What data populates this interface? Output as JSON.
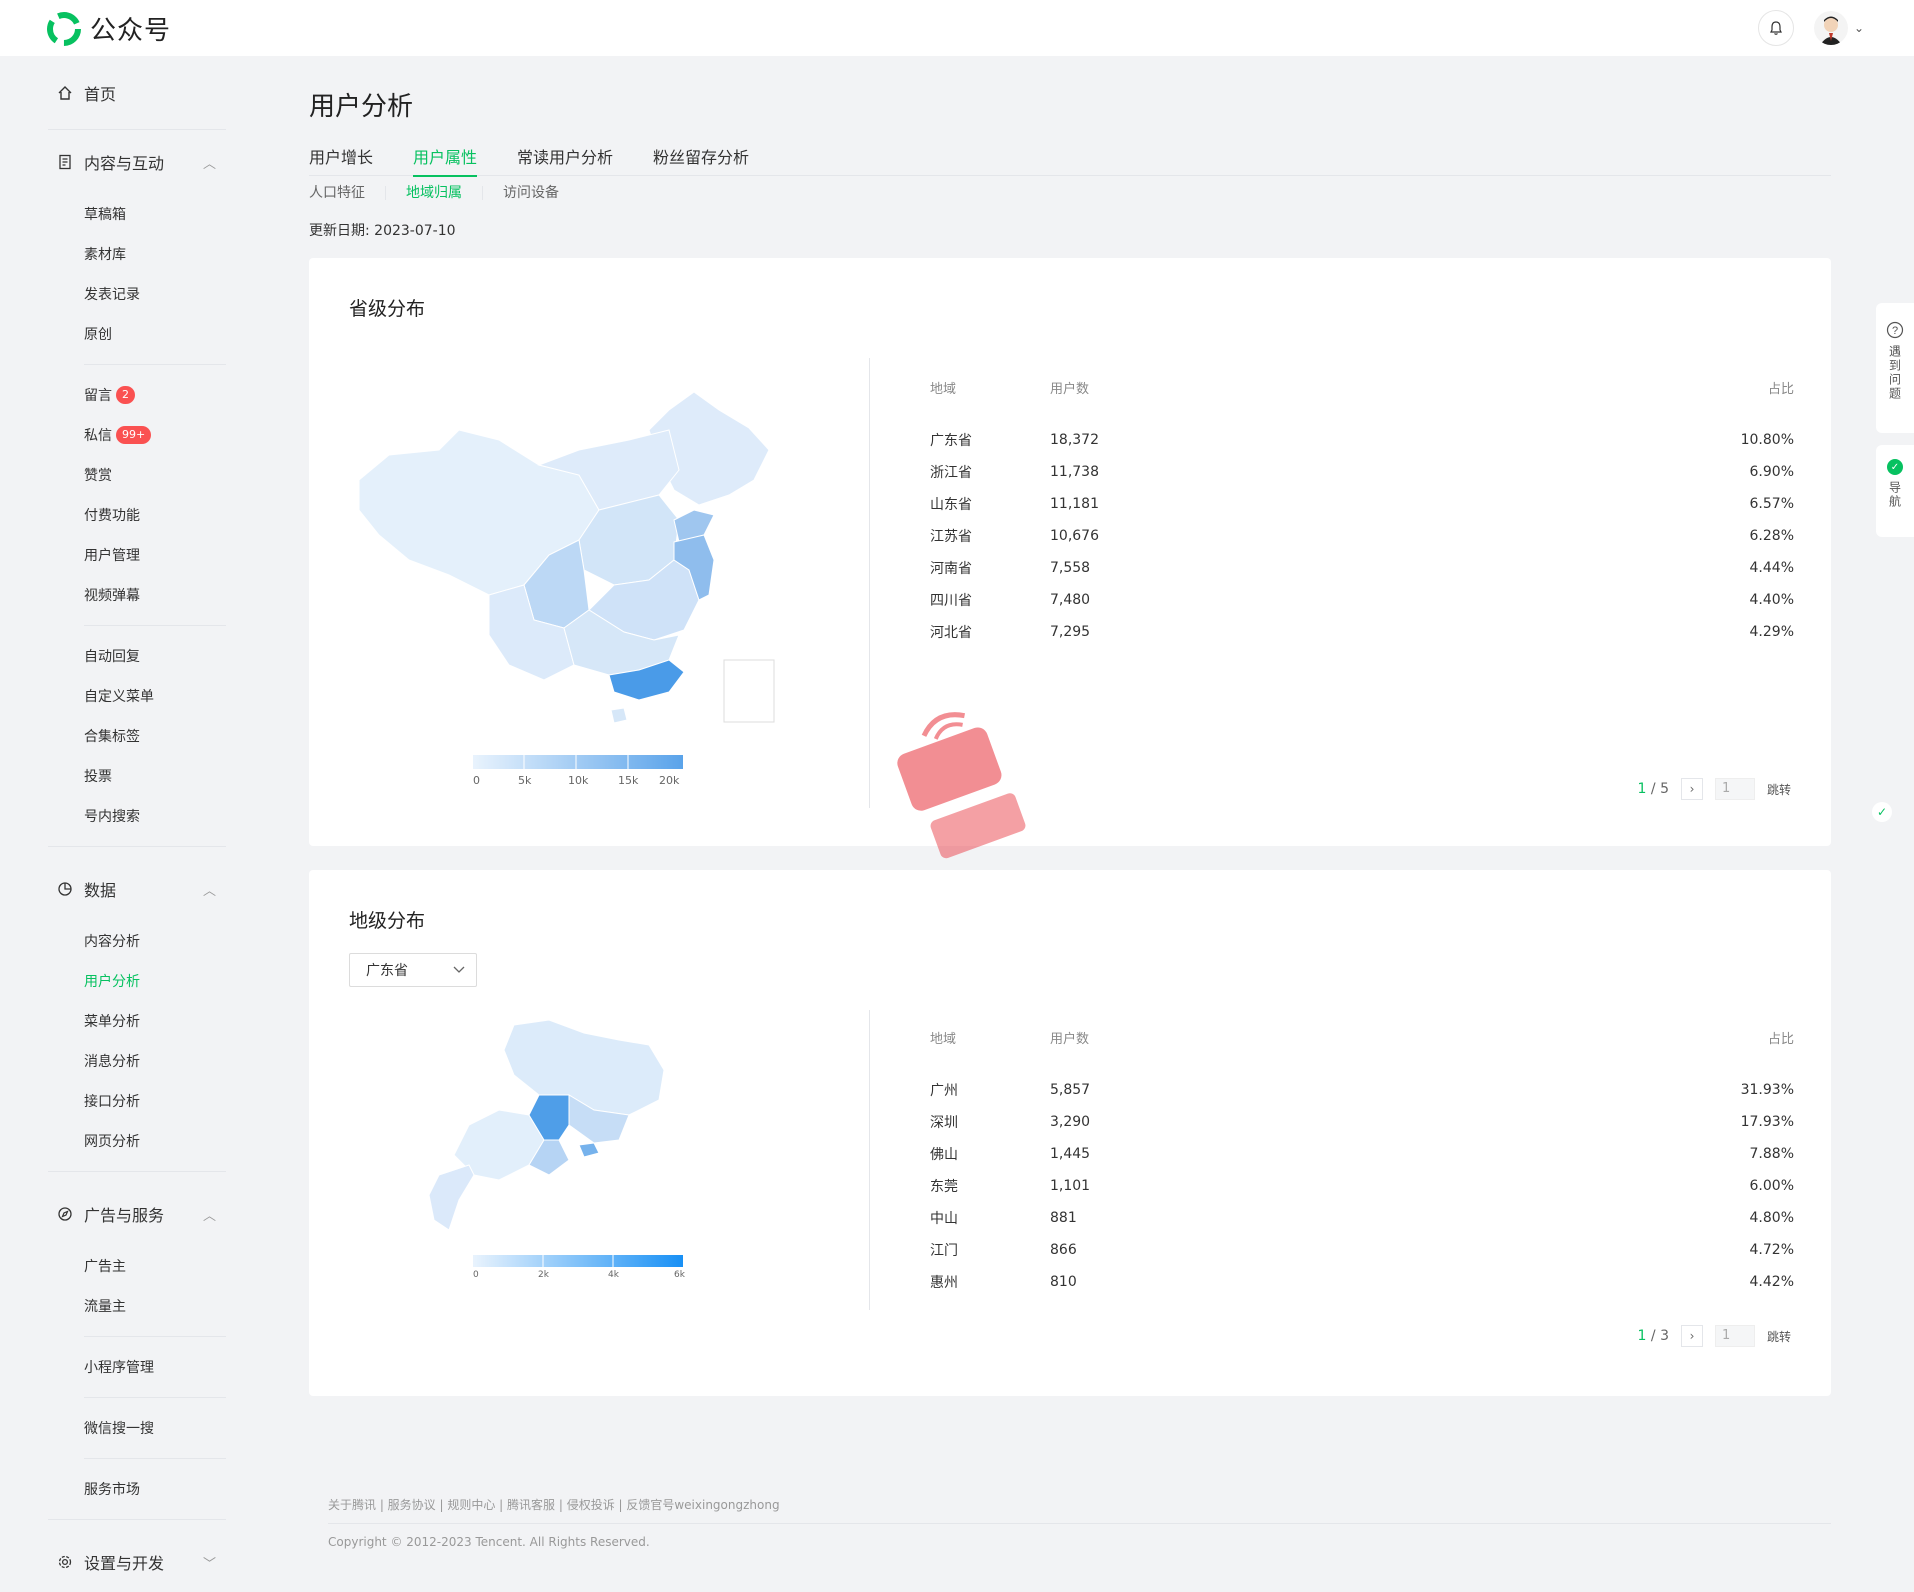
{
  "app": {
    "title": "公众号"
  },
  "sidebar": {
    "home": "首页",
    "content_group": "内容与互动",
    "content_items": [
      "草稿箱",
      "素材库",
      "发表记录",
      "原创"
    ],
    "interaction_items": [
      {
        "label": "留言",
        "badge": "2"
      },
      {
        "label": "私信",
        "badge": "99+"
      },
      {
        "label": "赞赏",
        "badge": ""
      },
      {
        "label": "付费功能",
        "badge": ""
      },
      {
        "label": "用户管理",
        "badge": ""
      },
      {
        "label": "视频弹幕",
        "badge": ""
      }
    ],
    "tools_items": [
      "自动回复",
      "自定义菜单",
      "合集标签",
      "投票",
      "号内搜索"
    ],
    "data_group": "数据",
    "data_items": [
      "内容分析",
      "用户分析",
      "菜单分析",
      "消息分析",
      "接口分析",
      "网页分析"
    ],
    "ads_group": "广告与服务",
    "ads_items": [
      "广告主",
      "流量主"
    ],
    "miniprogram": "小程序管理",
    "wxsearch": "微信搜一搜",
    "service_market": "服务市场",
    "settings_group": "设置与开发"
  },
  "main": {
    "title": "用户分析",
    "tabs": [
      "用户增长",
      "用户属性",
      "常读用户分析",
      "粉丝留存分析"
    ],
    "subtabs": [
      "人口特征",
      "地域归属",
      "访问设备"
    ],
    "update_label": "更新日期:",
    "update_date": "2023-07-10"
  },
  "province": {
    "title": "省级分布",
    "headers": [
      "地域",
      "用户数",
      "占比"
    ],
    "rows": [
      [
        "广东省",
        "18,372",
        "10.80%"
      ],
      [
        "浙江省",
        "11,738",
        "6.90%"
      ],
      [
        "山东省",
        "11,181",
        "6.57%"
      ],
      [
        "江苏省",
        "10,676",
        "6.28%"
      ],
      [
        "河南省",
        "7,558",
        "4.44%"
      ],
      [
        "四川省",
        "7,480",
        "4.40%"
      ],
      [
        "河北省",
        "7,295",
        "4.29%"
      ]
    ],
    "legend": [
      "0",
      "5k",
      "10k",
      "15k",
      "20k"
    ],
    "pager": {
      "current": "1",
      "total": "/ 5",
      "input": "1",
      "jump": "跳转"
    }
  },
  "city": {
    "title": "地级分布",
    "selected": "广东省",
    "headers": [
      "地域",
      "用户数",
      "占比"
    ],
    "rows": [
      [
        "广州",
        "5,857",
        "31.93%"
      ],
      [
        "深圳",
        "3,290",
        "17.93%"
      ],
      [
        "佛山",
        "1,445",
        "7.88%"
      ],
      [
        "东莞",
        "1,101",
        "6.00%"
      ],
      [
        "中山",
        "881",
        "4.80%"
      ],
      [
        "江门",
        "866",
        "4.72%"
      ],
      [
        "惠州",
        "810",
        "4.42%"
      ]
    ],
    "legend": [
      "0",
      "2k",
      "4k",
      "6k"
    ],
    "pager": {
      "current": "1",
      "total": "/ 3",
      "input": "1",
      "jump": "跳转"
    }
  },
  "footer": {
    "links": "关于腾讯 | 服务协议 | 规则中心 | 腾讯客服 | 侵权投诉 | 反馈官号weixingongzhong",
    "copyright": "Copyright © 2012-2023 Tencent. All Rights Reserved."
  },
  "float": {
    "help": "遇到问题",
    "nav": "导航"
  },
  "colors": {
    "accent": "#07c160",
    "badge": "#fa5151",
    "map_low": "#e4f0fb",
    "map_high": "#4a9be8"
  }
}
